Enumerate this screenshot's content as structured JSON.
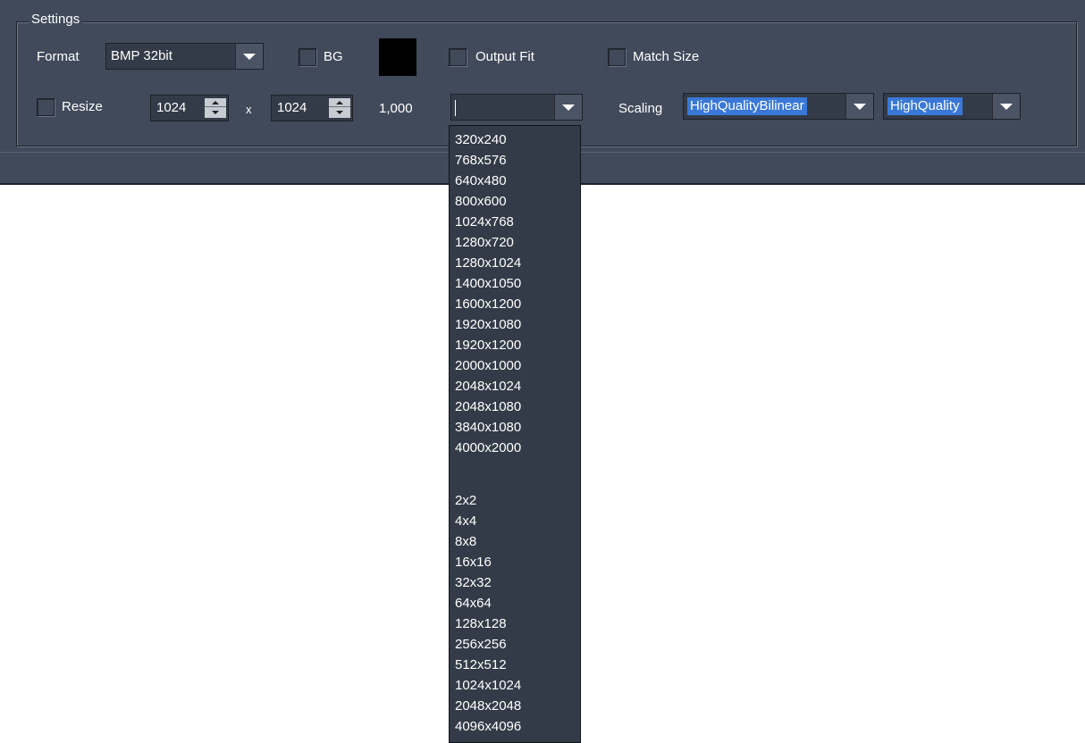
{
  "settings": {
    "title": "Settings",
    "format_label": "Format",
    "format_value": "BMP 32bit",
    "bg_label": "BG",
    "bg_color": "#000000",
    "output_fit_label": "Output Fit",
    "match_size_label": "Match Size",
    "resize_label": "Resize",
    "width_value": "1024",
    "times_label": "x",
    "height_value": "1024",
    "ratio_value": "1,000",
    "preset_value": "",
    "scaling_label": "Scaling",
    "scaling_mode": "HighQualityBilinear",
    "quality_mode": "HighQuality"
  },
  "preset_options": [
    "320x240",
    "768x576",
    "640x480",
    "800x600",
    "1024x768",
    "1280x720",
    "1280x1024",
    "1400x1050",
    "1600x1200",
    "1920x1080",
    "1920x1200",
    "2000x1000",
    "2048x1024",
    "2048x1080",
    "3840x1080",
    "4000x2000",
    "",
    "2x2",
    "4x4",
    "8x8",
    "16x16",
    "32x32",
    "64x64",
    "128x128",
    "256x256",
    "512x512",
    "1024x1024",
    "2048x2048",
    "4096x4096"
  ],
  "colors": {
    "panel": "#404a5a",
    "field": "#333b48",
    "selection": "#3a78d8",
    "text": "#ffffff"
  }
}
